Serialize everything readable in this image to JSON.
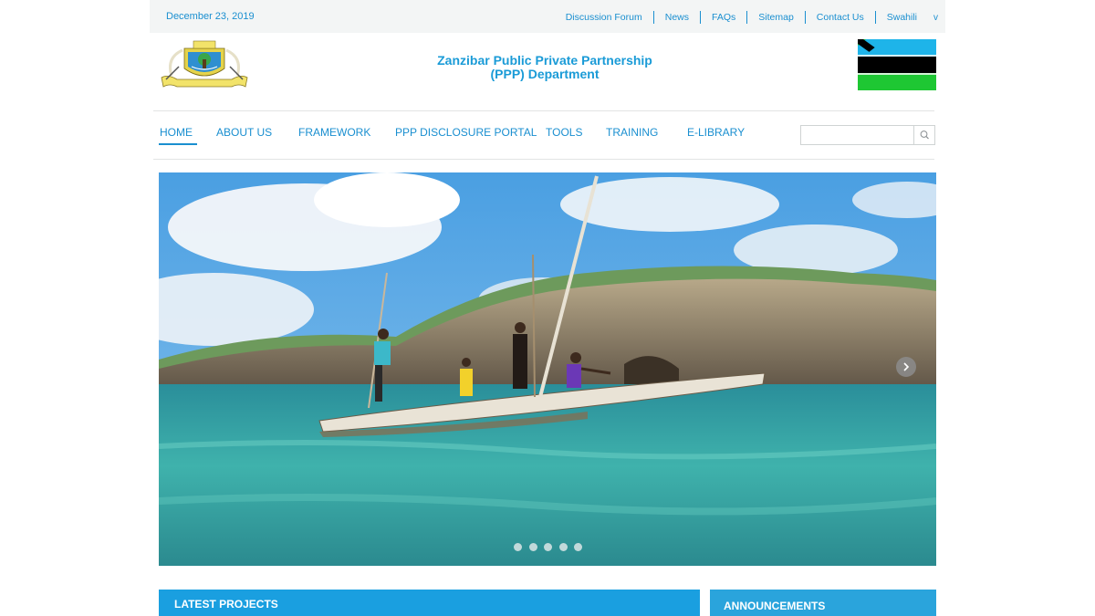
{
  "topbar": {
    "date": "December 23, 2019",
    "links": [
      "Discussion Forum",
      "News",
      "FAQs",
      "Sitemap",
      "Contact Us"
    ],
    "language": "Swahili",
    "language_caret": "v"
  },
  "header": {
    "title_line1": "Zanzibar Public Private Partnership",
    "title_line2": "(PPP) Department"
  },
  "nav": {
    "items": [
      "HOME",
      "ABOUT US",
      "FRAMEWORK",
      "PPP DISCLOSURE PORTAL",
      "TOOLS",
      "TRAINING",
      "E-LIBRARY"
    ],
    "active": "HOME",
    "search_placeholder": ""
  },
  "slider": {
    "slide_count": 5,
    "next_label": "›"
  },
  "panels": {
    "latest_projects": "LATEST PROJECTS",
    "announcements": "ANNOUNCEMENTS"
  },
  "colors": {
    "accent": "#1a9bd7",
    "panel_blue": "#1a9fe0",
    "flag_blue": "#1eb4e9",
    "flag_black": "#000000",
    "flag_green": "#1ec733"
  }
}
